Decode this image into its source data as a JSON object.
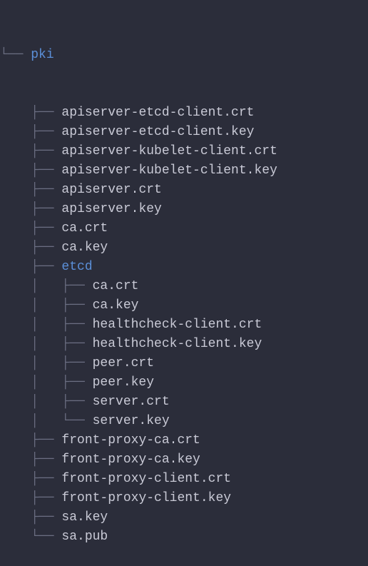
{
  "tree": {
    "root_prefix": "└── ",
    "root_name": "pki",
    "root_is_dir": true,
    "children": [
      {
        "prefix": "    ├── ",
        "name": "apiserver-etcd-client.crt",
        "dir": false
      },
      {
        "prefix": "    ├── ",
        "name": "apiserver-etcd-client.key",
        "dir": false
      },
      {
        "prefix": "    ├── ",
        "name": "apiserver-kubelet-client.crt",
        "dir": false
      },
      {
        "prefix": "    ├── ",
        "name": "apiserver-kubelet-client.key",
        "dir": false
      },
      {
        "prefix": "    ├── ",
        "name": "apiserver.crt",
        "dir": false
      },
      {
        "prefix": "    ├── ",
        "name": "apiserver.key",
        "dir": false
      },
      {
        "prefix": "    ├── ",
        "name": "ca.crt",
        "dir": false
      },
      {
        "prefix": "    ├── ",
        "name": "ca.key",
        "dir": false
      },
      {
        "prefix": "    ├── ",
        "name": "etcd",
        "dir": true
      },
      {
        "prefix": "    │   ├── ",
        "name": "ca.crt",
        "dir": false
      },
      {
        "prefix": "    │   ├── ",
        "name": "ca.key",
        "dir": false
      },
      {
        "prefix": "    │   ├── ",
        "name": "healthcheck-client.crt",
        "dir": false
      },
      {
        "prefix": "    │   ├── ",
        "name": "healthcheck-client.key",
        "dir": false
      },
      {
        "prefix": "    │   ├── ",
        "name": "peer.crt",
        "dir": false
      },
      {
        "prefix": "    │   ├── ",
        "name": "peer.key",
        "dir": false
      },
      {
        "prefix": "    │   ├── ",
        "name": "server.crt",
        "dir": false
      },
      {
        "prefix": "    │   └── ",
        "name": "server.key",
        "dir": false
      },
      {
        "prefix": "    ├── ",
        "name": "front-proxy-ca.crt",
        "dir": false
      },
      {
        "prefix": "    ├── ",
        "name": "front-proxy-ca.key",
        "dir": false
      },
      {
        "prefix": "    ├── ",
        "name": "front-proxy-client.crt",
        "dir": false
      },
      {
        "prefix": "    ├── ",
        "name": "front-proxy-client.key",
        "dir": false
      },
      {
        "prefix": "    ├── ",
        "name": "sa.key",
        "dir": false
      },
      {
        "prefix": "    └── ",
        "name": "sa.pub",
        "dir": false
      }
    ]
  }
}
